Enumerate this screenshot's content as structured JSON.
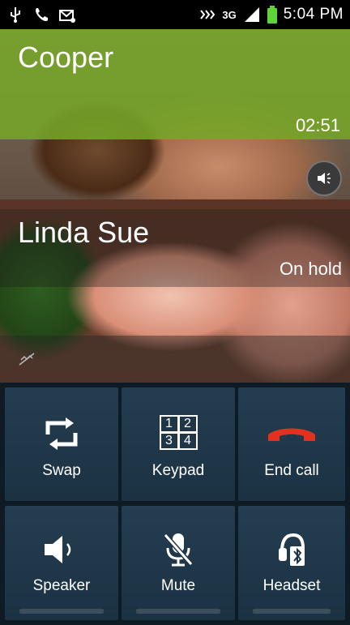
{
  "status_bar": {
    "left_icons": [
      "usb-icon",
      "phone-icon",
      "mail-icon"
    ],
    "right_icons": [
      "nfc-icon",
      "3g-icon",
      "signal-icon",
      "battery-icon"
    ],
    "network": "3G",
    "time": "5:04 PM"
  },
  "calls": {
    "active": {
      "name": "Cooper",
      "duration": "02:51"
    },
    "held": {
      "name": "Linda Sue",
      "status": "On hold"
    }
  },
  "buttons": {
    "swap": "Swap",
    "keypad": "Keypad",
    "end_call": "End call",
    "speaker": "Speaker",
    "mute": "Mute",
    "headset": "Headset"
  },
  "keypad_digits": [
    "1",
    "2",
    "3",
    "4"
  ],
  "colors": {
    "active_band": "#76a828",
    "end_call_red": "#e0321e",
    "button_bg": "#1f3648"
  }
}
